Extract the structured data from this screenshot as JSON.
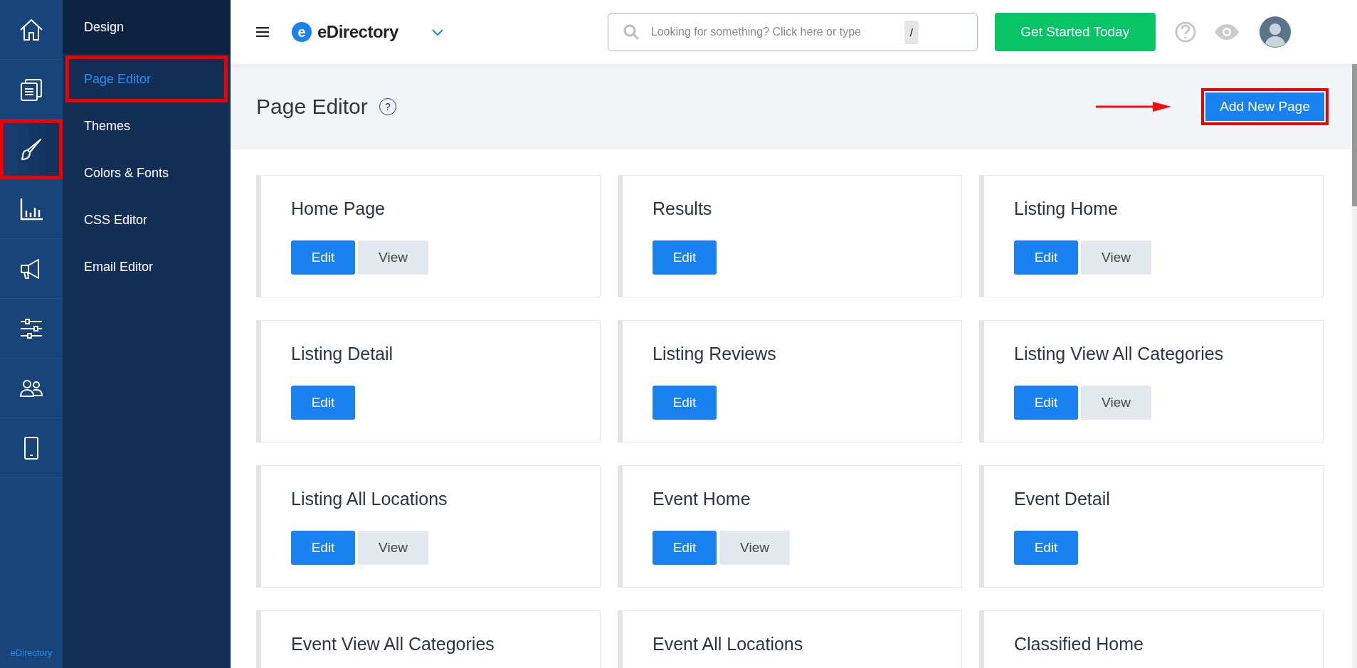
{
  "rail": {
    "items": [
      {
        "selected": false,
        "highlighted": false
      },
      {
        "selected": false,
        "highlighted": false
      },
      {
        "selected": true,
        "highlighted": true
      },
      {
        "selected": false,
        "highlighted": false
      },
      {
        "selected": false,
        "highlighted": false
      },
      {
        "selected": false,
        "highlighted": false
      },
      {
        "selected": false,
        "highlighted": false
      },
      {
        "selected": false,
        "highlighted": false
      }
    ],
    "footer": "eDirectory"
  },
  "subnav": {
    "title": "Design",
    "items": [
      {
        "label": "Page Editor",
        "selected": true,
        "highlighted": true
      },
      {
        "label": "Themes",
        "selected": false,
        "highlighted": false
      },
      {
        "label": "Colors & Fonts",
        "selected": false,
        "highlighted": false
      },
      {
        "label": "CSS Editor",
        "selected": false,
        "highlighted": false
      },
      {
        "label": "Email Editor",
        "selected": false,
        "highlighted": false
      }
    ]
  },
  "topbar": {
    "logo_letter": "e",
    "brand": "eDirectory",
    "search": {
      "placeholder": "Looking for something? Click here or type",
      "shortcut": "/"
    },
    "cta": "Get Started Today"
  },
  "header": {
    "title": "Page Editor",
    "help": "?",
    "button": {
      "label": "Add New Page",
      "highlighted": true
    }
  },
  "cards": [
    {
      "title": "Home Page",
      "buttons": [
        "Edit",
        "View"
      ]
    },
    {
      "title": "Results",
      "buttons": [
        "Edit"
      ]
    },
    {
      "title": "Listing Home",
      "buttons": [
        "Edit",
        "View"
      ]
    },
    {
      "title": "Listing Detail",
      "buttons": [
        "Edit"
      ]
    },
    {
      "title": "Listing Reviews",
      "buttons": [
        "Edit"
      ]
    },
    {
      "title": "Listing View All Categories",
      "buttons": [
        "Edit",
        "View"
      ]
    },
    {
      "title": "Listing All Locations",
      "buttons": [
        "Edit",
        "View"
      ]
    },
    {
      "title": "Event Home",
      "buttons": [
        "Edit",
        "View"
      ]
    },
    {
      "title": "Event Detail",
      "buttons": [
        "Edit"
      ]
    },
    {
      "title": "Event View All Categories"
    },
    {
      "title": "Event All Locations"
    },
    {
      "title": "Classified Home"
    }
  ]
}
